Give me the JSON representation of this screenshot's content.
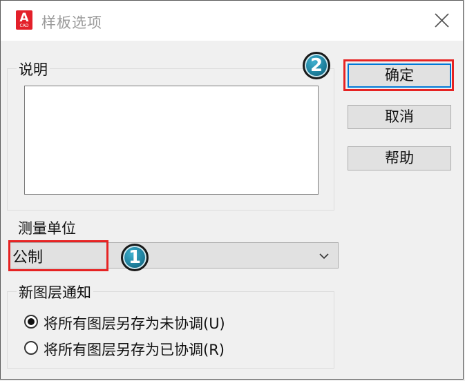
{
  "window": {
    "title": "样板选项",
    "app_icon": {
      "letter": "A",
      "sub": "CAD",
      "color": "#e3202a"
    }
  },
  "description": {
    "label": "说明",
    "value": ""
  },
  "buttons": {
    "ok": "确定",
    "cancel": "取消",
    "help": "帮助"
  },
  "measurement": {
    "label": "测量单位",
    "selected": "公制"
  },
  "new_layer_notification": {
    "label": "新图层通知",
    "options": [
      {
        "label": "将所有图层另存为未协调(U)",
        "checked": true
      },
      {
        "label": "将所有图层另存为已协调(R)",
        "checked": false
      }
    ]
  },
  "callouts": [
    "1",
    "2"
  ],
  "colors": {
    "highlight": "#e62323",
    "callout": "#1e7f9c"
  }
}
